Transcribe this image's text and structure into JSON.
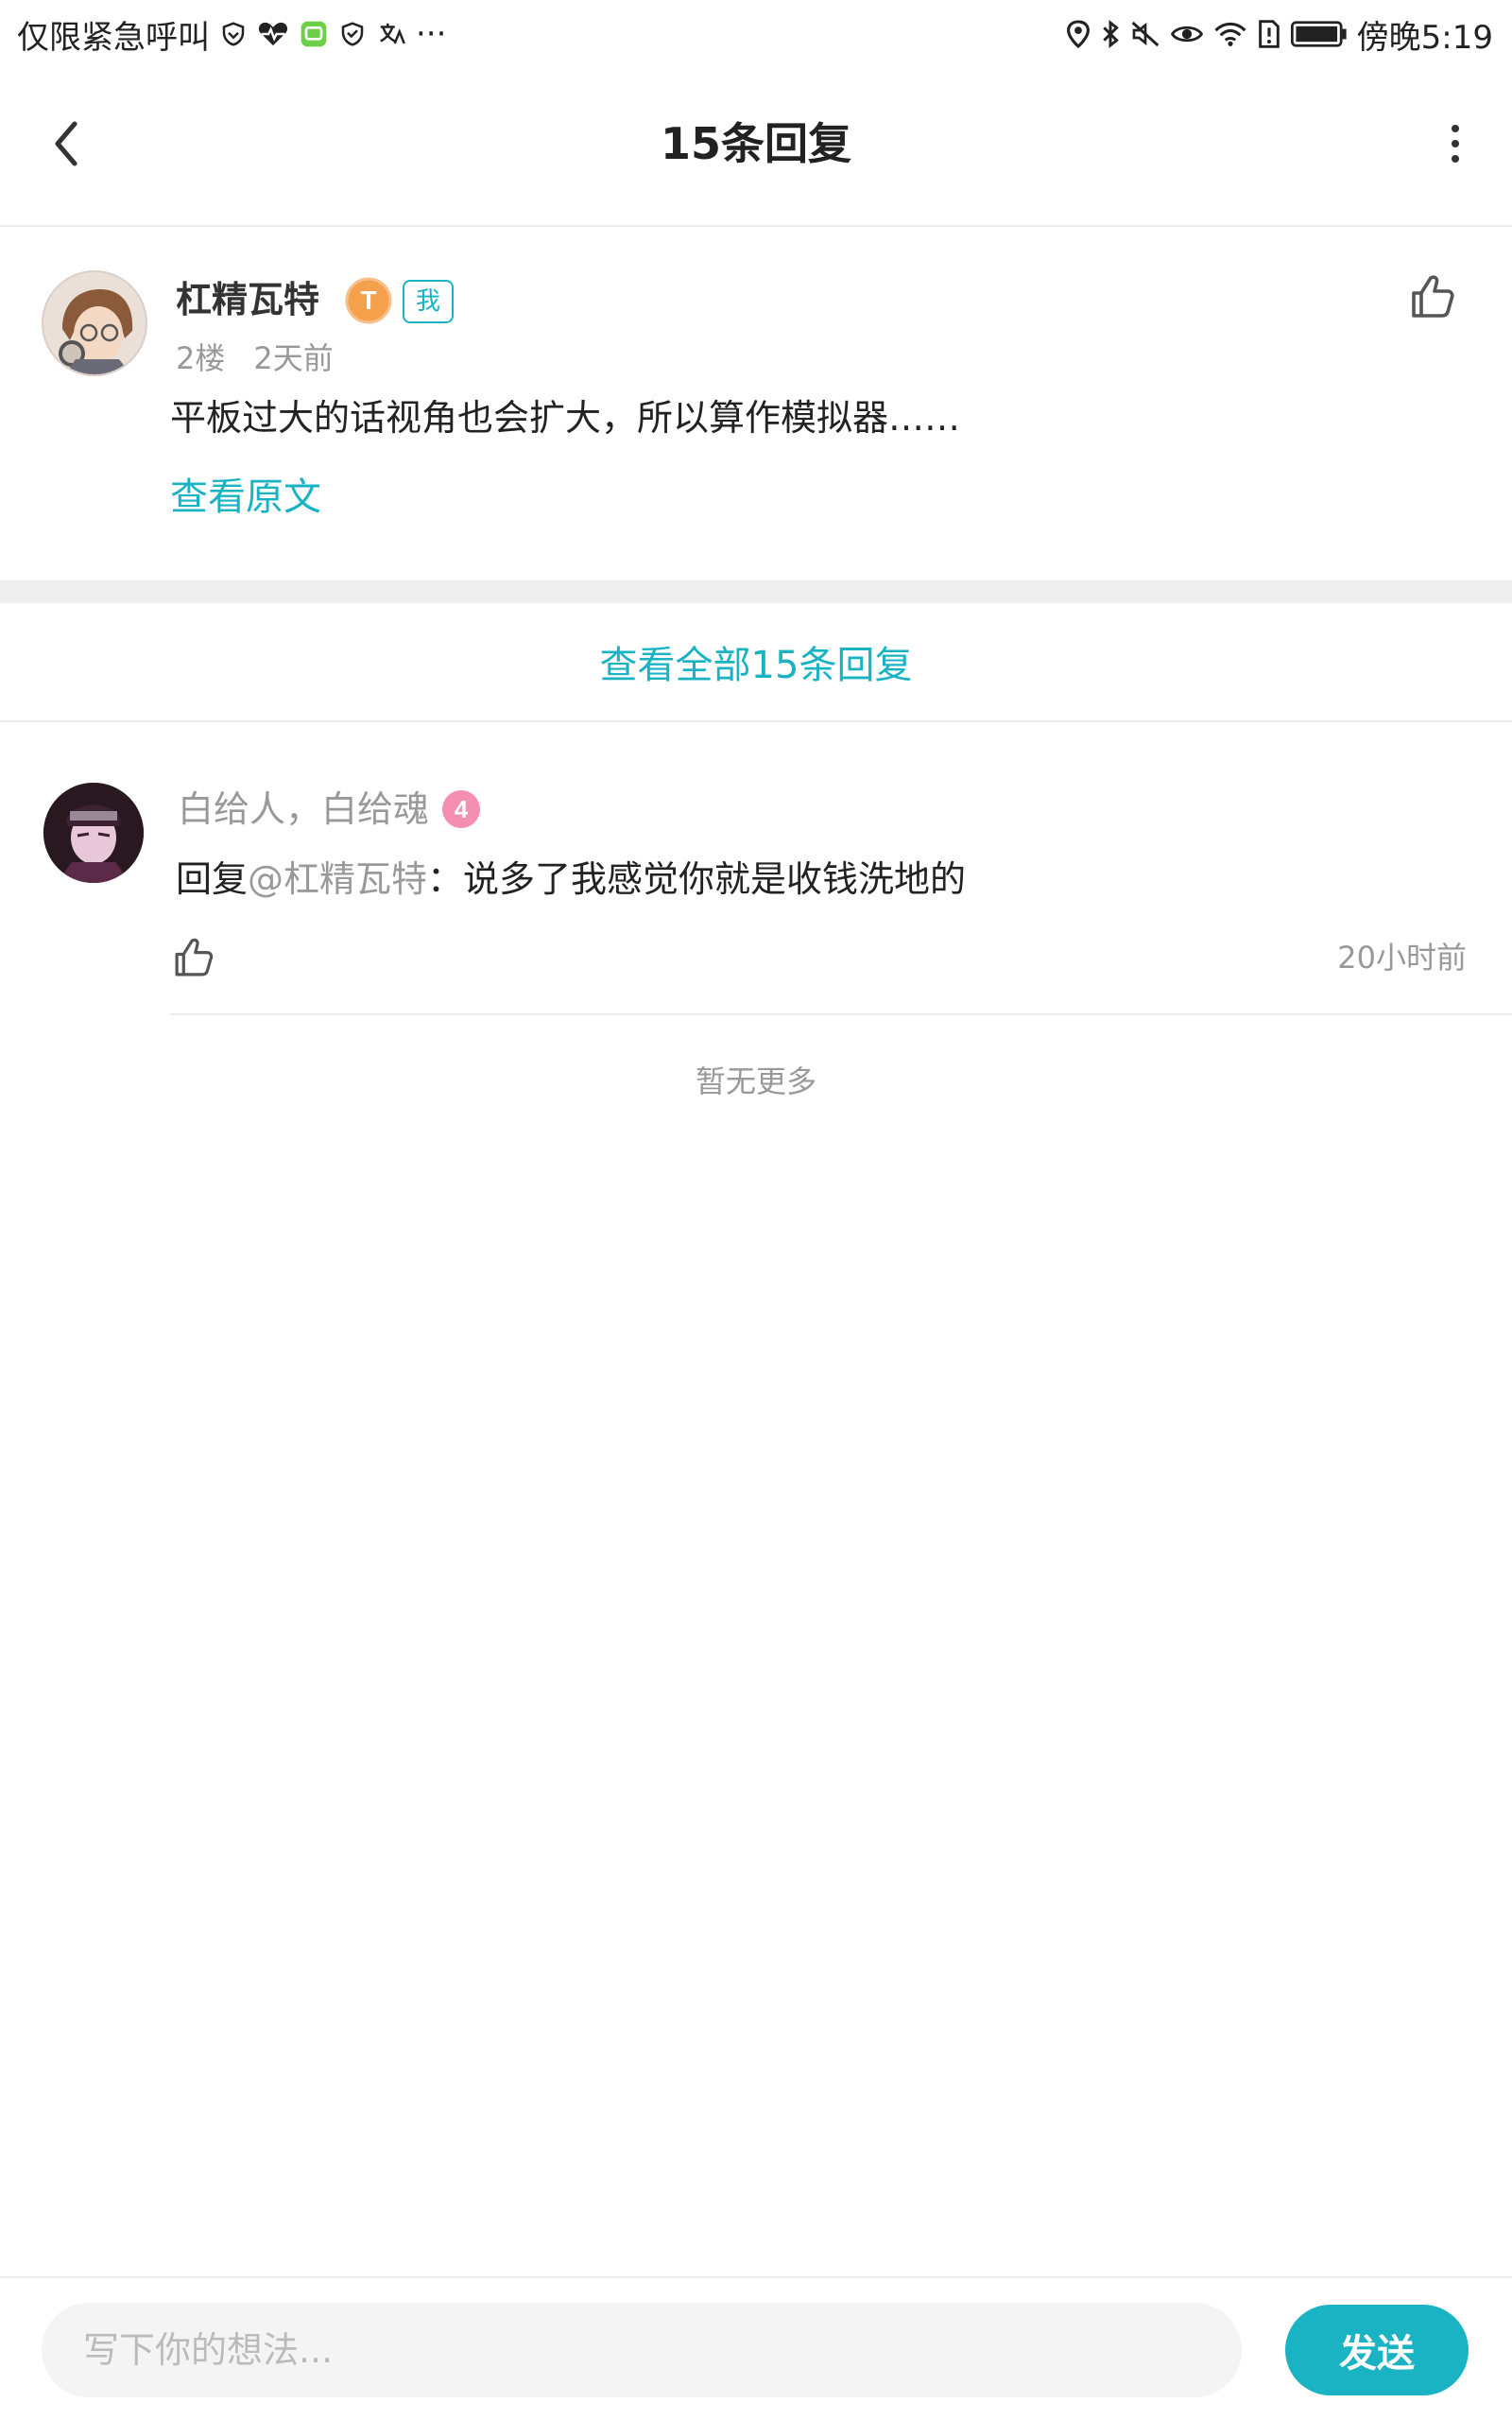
{
  "status_bar": {
    "carrier_text": "仅限紧急呼叫",
    "overflow": "···",
    "time": "傍晚5:19",
    "left_icons": [
      "shield-icon",
      "heart-rate-icon",
      "app-notification-icon",
      "shield-icon",
      "translate-icon"
    ],
    "right_icons": [
      "location-icon",
      "bluetooth-icon",
      "mute-icon",
      "eye-icon",
      "wifi-icon",
      "sim-alert-icon",
      "battery-icon"
    ]
  },
  "header": {
    "title": "15条回复",
    "back_icon": "chevron-left-icon",
    "more_icon": "more-vertical-icon"
  },
  "main_comment": {
    "author": "杠精瓦特",
    "level_badge": "T",
    "me_badge": "我",
    "floor": "2楼",
    "time": "2天前",
    "text": "平板过大的话视角也会扩大，所以算作模拟器……",
    "view_original": "查看原文"
  },
  "view_all": "查看全部15条回复",
  "reply": {
    "author": "白给人，白给魂",
    "level": "4",
    "prefix": "回复",
    "mention": "@杠精瓦特",
    "separator": "：",
    "text": "说多了我感觉你就是收钱洗地的",
    "time": "20小时前"
  },
  "no_more": "暂无更多",
  "input": {
    "placeholder": "写下你的想法...",
    "send_label": "发送"
  },
  "colors": {
    "accent": "#1ab3c4",
    "level_orange": "#f5a04a",
    "level_pink": "#f48fb1",
    "muted": "#999999"
  }
}
